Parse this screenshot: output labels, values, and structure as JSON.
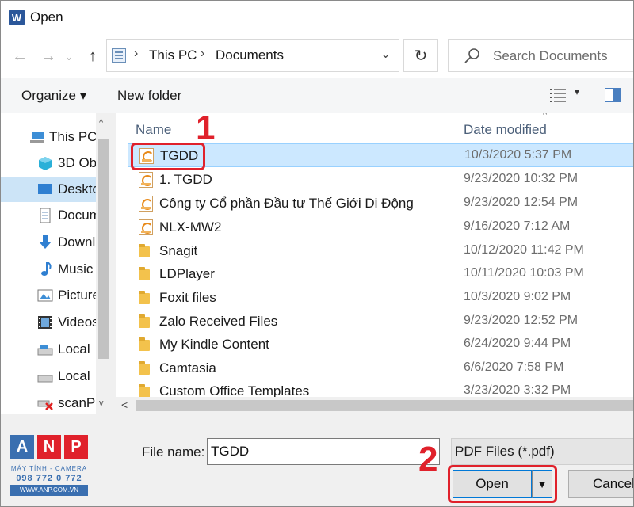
{
  "window": {
    "title": "Open",
    "app_icon": "W"
  },
  "nav": {
    "back_icon": "←",
    "forward_icon": "→",
    "recent_icon": "⌄",
    "up_icon": "↑",
    "address": {
      "segments": [
        "This PC",
        "Documents"
      ],
      "separator": "›",
      "dropdown": "⌄"
    },
    "refresh_icon": "↻",
    "search": {
      "placeholder": "Search Documents"
    }
  },
  "toolbar": {
    "organize": "Organize ▾",
    "new_folder": "New folder",
    "view_drop": "▾"
  },
  "sidebar": {
    "items": [
      {
        "label": "This PC",
        "icon": "pc-icon"
      },
      {
        "label": "3D Ob",
        "icon": "cube-icon"
      },
      {
        "label": "Deskto",
        "icon": "desktop-icon",
        "selected": true
      },
      {
        "label": "Docum",
        "icon": "document-icon"
      },
      {
        "label": "Downl",
        "icon": "download-icon"
      },
      {
        "label": "Music",
        "icon": "music-icon"
      },
      {
        "label": "Picture",
        "icon": "picture-icon"
      },
      {
        "label": "Videos",
        "icon": "video-icon"
      },
      {
        "label": "Local",
        "icon": "drive-icon"
      },
      {
        "label": "Local",
        "icon": "drive-icon"
      },
      {
        "label": "scanP",
        "icon": "network-drive-icon"
      }
    ],
    "scroll_up": "^",
    "scroll_down": "v"
  },
  "filelist": {
    "columns": {
      "name": "Name",
      "date": "Date modified",
      "sort_indicator": "^"
    },
    "rows": [
      {
        "name": "TGDD",
        "date": "10/3/2020 5:37 PM",
        "type": "pdf",
        "selected": true
      },
      {
        "name": "1. TGDD",
        "date": "9/23/2020 10:32 PM",
        "type": "pdf"
      },
      {
        "name": "Công ty Cổ phần Đầu tư Thế Giới Di Động",
        "date": "9/23/2020 12:54 PM",
        "type": "pdf"
      },
      {
        "name": "NLX-MW2",
        "date": "9/16/2020 7:12 AM",
        "type": "pdf"
      },
      {
        "name": "Snagit",
        "date": "10/12/2020 11:42 PM",
        "type": "folder"
      },
      {
        "name": "LDPlayer",
        "date": "10/11/2020 10:03 PM",
        "type": "folder"
      },
      {
        "name": "Foxit files",
        "date": "10/3/2020 9:02 PM",
        "type": "folder"
      },
      {
        "name": "Zalo Received Files",
        "date": "9/23/2020 12:52 PM",
        "type": "folder"
      },
      {
        "name": "My Kindle Content",
        "date": "6/24/2020 9:44 PM",
        "type": "folder"
      },
      {
        "name": "Camtasia",
        "date": "6/6/2020 7:58 PM",
        "type": "folder"
      },
      {
        "name": "Custom Office Templates",
        "date": "3/23/2020 3:32 PM",
        "type": "folder"
      }
    ],
    "hscroll_left": "<"
  },
  "annotations": {
    "step1": "1",
    "step2": "2",
    "highlight_color": "#e0212b"
  },
  "bottom": {
    "file_name_label": "File name:",
    "file_name_value": "TGDD",
    "file_type": "PDF Files (*.pdf)",
    "open_label": "Open",
    "open_dropdown": "▼",
    "cancel_label": "Cancel"
  },
  "watermark": {
    "letters": [
      "A",
      "N",
      "P"
    ],
    "line1": "MÁY TÍNH - CAMERA",
    "line2": "098 772 0 772",
    "line3": "WWW.ANP.COM.VN"
  }
}
